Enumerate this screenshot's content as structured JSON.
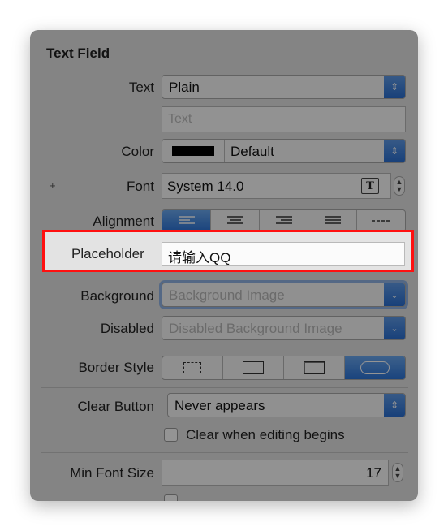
{
  "section_title": "Text Field",
  "text": {
    "label": "Text",
    "value": "Plain",
    "placeholder": "Text"
  },
  "color": {
    "label": "Color",
    "value": "Default",
    "swatch": "#000000"
  },
  "font": {
    "label": "Font",
    "value": "System 14.0",
    "plus": "+",
    "font_button": "T"
  },
  "alignment": {
    "label": "Alignment",
    "options": [
      "left",
      "center",
      "right",
      "justified",
      "natural"
    ],
    "selected": "left"
  },
  "placeholder": {
    "label": "Placeholder",
    "value": "请输入QQ"
  },
  "background": {
    "label": "Background",
    "placeholder": "Background Image"
  },
  "disabled": {
    "label": "Disabled",
    "placeholder": "Disabled Background Image"
  },
  "border_style": {
    "label": "Border Style",
    "options": [
      "none",
      "line",
      "bezel",
      "rounded"
    ],
    "selected": "rounded"
  },
  "clear_button": {
    "label": "Clear Button",
    "value": "Never appears",
    "checkbox_label": "Clear when editing begins"
  },
  "min_font_size": {
    "label": "Min Font Size",
    "value": "17"
  },
  "colors": {
    "highlight": "#ff1010",
    "accent": "#2c74d8"
  }
}
